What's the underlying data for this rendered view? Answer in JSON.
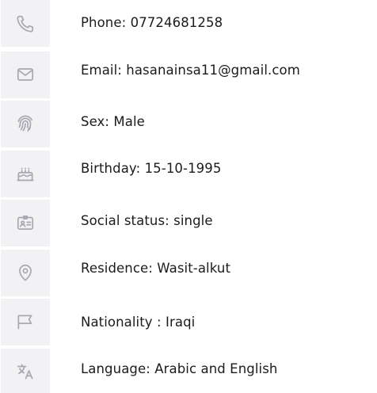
{
  "profile_details": {
    "items": [
      {
        "icon": "phone-icon",
        "text": "Phone: 07724681258"
      },
      {
        "icon": "mail-icon",
        "text": "Email: hasanainsa11@gmail.com"
      },
      {
        "icon": "fingerprint-icon",
        "text": "Sex: Male"
      },
      {
        "icon": "cake-icon",
        "text": "Birthday: 15-10-1995"
      },
      {
        "icon": "id-card-icon",
        "text": "Social status: single"
      },
      {
        "icon": "location-pin-icon",
        "text": "Residence: Wasit-alkut"
      },
      {
        "icon": "flag-icon",
        "text": "Nationality : Iraqi"
      },
      {
        "icon": "translate-icon",
        "text": "Language: Arabic and  English"
      }
    ]
  },
  "colors": {
    "icon_tile_bg": "#f2f2f4",
    "icon_stroke": "#a9a9b3",
    "text": "#1b1b1b"
  }
}
